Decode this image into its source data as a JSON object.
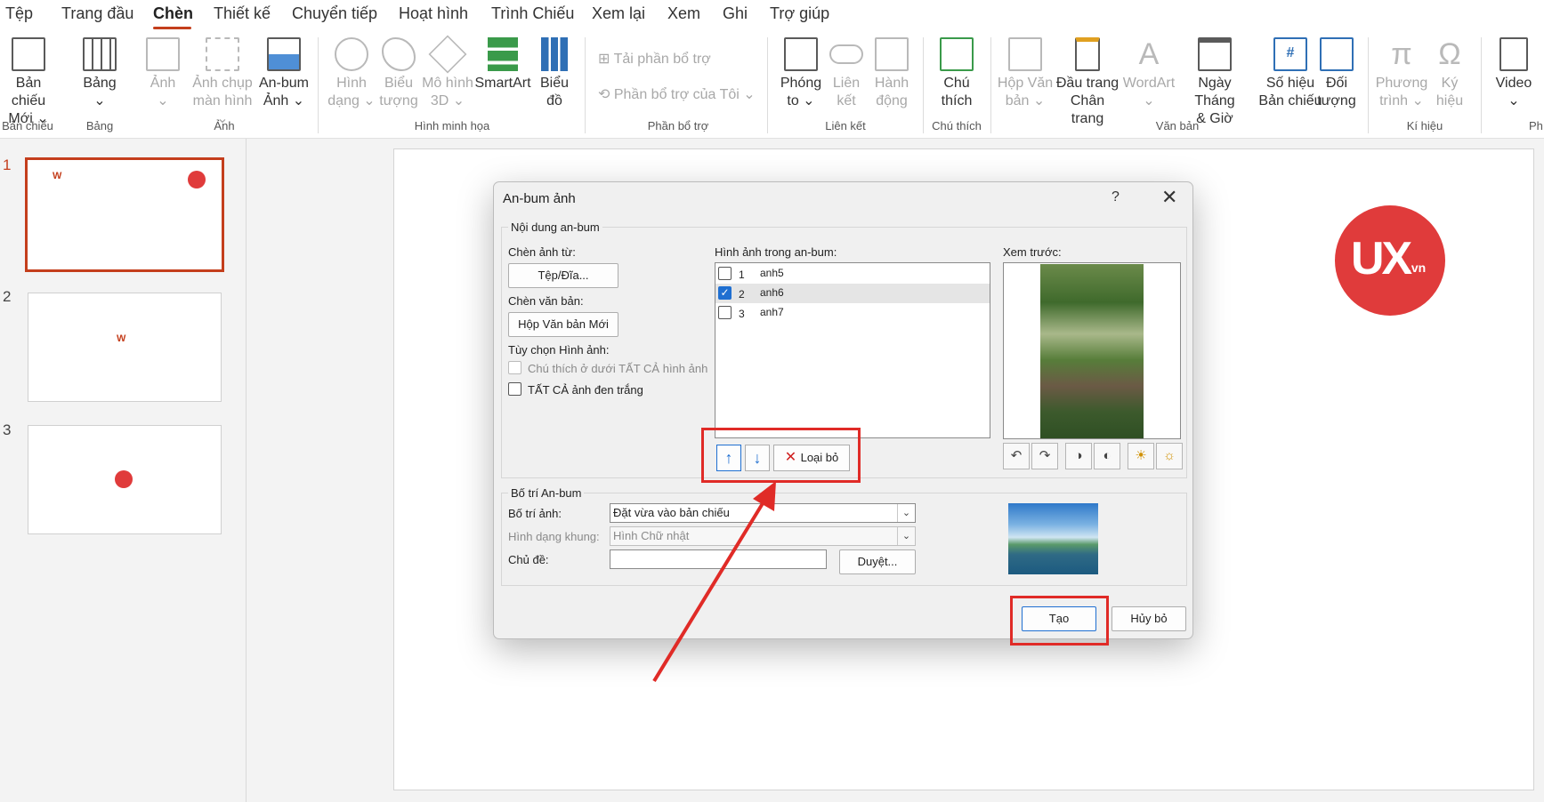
{
  "menu_tabs": [
    "Tệp",
    "Trang đầu",
    "Chèn",
    "Thiết kế",
    "Chuyển tiếp",
    "Hoạt hình",
    "Trình Chiếu",
    "Xem lại",
    "Xem",
    "Ghi",
    "Trợ giúp"
  ],
  "active_tab": "Chèn",
  "ribbon": {
    "new_slide": [
      "Bản chiếu",
      "Mới ⌄"
    ],
    "table": [
      "Bảng",
      "⌄"
    ],
    "picture": [
      "Ảnh",
      "⌄"
    ],
    "screenshot": [
      "Ảnh chụp",
      "màn hình ⌄"
    ],
    "album": [
      "An-bum",
      "Ảnh ⌄"
    ],
    "shapes": [
      "Hình",
      "dạng ⌄"
    ],
    "icons": [
      "Biểu",
      "tượng"
    ],
    "models3d": [
      "Mô hình",
      "3D ⌄"
    ],
    "smartart": [
      "SmartArt",
      ""
    ],
    "chart": [
      "Biểu",
      "đồ"
    ],
    "get_addins": "Tải phần bổ trợ",
    "my_addins": "Phần bổ trợ của Tôi  ⌄",
    "zoom": [
      "Phóng",
      "to ⌄"
    ],
    "link": [
      "Liên",
      "kết"
    ],
    "action": [
      "Hành",
      "động"
    ],
    "comment": [
      "Chú",
      "thích"
    ],
    "textbox": [
      "Hộp Văn",
      "bản ⌄"
    ],
    "header_footer": [
      "Đầu trang",
      "Chân trang"
    ],
    "wordart": [
      "WordArt",
      "⌄"
    ],
    "datetime": [
      "Ngày Tháng",
      "& Giờ"
    ],
    "slide_number": [
      "Số hiệu",
      "Bản chiếu"
    ],
    "object": [
      "Đối",
      "tượng"
    ],
    "equation": [
      "Phương",
      "trình ⌄"
    ],
    "symbol": [
      "Ký",
      "hiệu"
    ],
    "video": [
      "Video",
      "⌄"
    ],
    "groups": {
      "slides": "Bản chiếu",
      "tables": "Bảng",
      "images": "Ảnh",
      "illustrations": "Hình minh họa",
      "addins": "Phần bổ trợ",
      "links": "Liên kết",
      "comments": "Chú thích",
      "text": "Văn bản",
      "symbols": "Kí hiệu",
      "media": "Ph"
    }
  },
  "slides": [
    "1",
    "2",
    "3"
  ],
  "slide_logo": {
    "text": "UX",
    "suffix": ".vn"
  },
  "dialog": {
    "title": "An-bum ảnh",
    "help": "?",
    "close": "✕",
    "album_content": "Nội dung an-bum",
    "insert_from": "Chèn ảnh từ:",
    "file_disk_button": "Tệp/Đĩa...",
    "insert_text": "Chèn văn bản:",
    "new_textbox_button": "Hộp Văn bản Mới",
    "picture_options": "Tùy chọn Hình ảnh:",
    "captions_option": "Chú thích ở dưới TẤT CẢ hình ảnh",
    "bw_option": "TẤT CẢ ảnh đen trắng",
    "pictures_in_album": "Hình ảnh trong an-bum:",
    "pictures": [
      {
        "index": "1",
        "name": "anh5",
        "checked": false
      },
      {
        "index": "2",
        "name": "anh6",
        "checked": true
      },
      {
        "index": "3",
        "name": "anh7",
        "checked": false
      }
    ],
    "move_up": "↑",
    "move_down": "↓",
    "remove_button": "Loại bỏ",
    "preview_label": "Xem trước:",
    "album_layout": "Bố trí An-bum",
    "picture_layout_label": "Bố trí ảnh:",
    "picture_layout_value": "Đặt vừa vào bản chiếu",
    "frame_shape_label": "Hình dạng khung:",
    "frame_shape_value": "Hình Chữ nhật",
    "theme_label": "Chủ đề:",
    "theme_value": "",
    "browse_button": "Duyệt...",
    "create_button": "Tạo",
    "cancel_button": "Hủy bỏ"
  },
  "colors": {
    "accent": "#c43e1c",
    "annotation_red": "#e02b27",
    "check_blue": "#1f6fd1",
    "logo_red": "#e03b3b"
  }
}
